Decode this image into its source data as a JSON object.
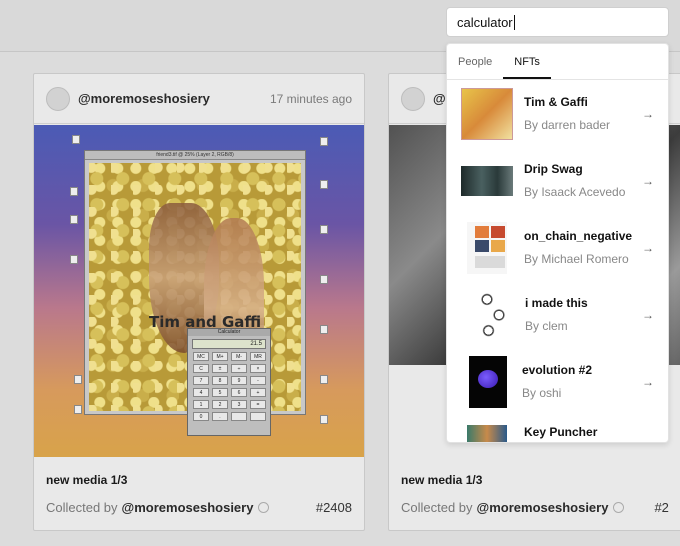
{
  "search": {
    "value": "calculator"
  },
  "tabs": [
    {
      "label": "People",
      "active": false
    },
    {
      "label": "NFTs",
      "active": true
    }
  ],
  "results": [
    {
      "name": "Tim & Gaffi",
      "by": "By darren bader"
    },
    {
      "name": "Drip Swag",
      "by": "By Isaack Acevedo"
    },
    {
      "name": "on_chain_negative",
      "by": "By Michael Romero"
    },
    {
      "name": "i made this",
      "by": "By clem"
    },
    {
      "name": "evolution #2",
      "by": "By oshi"
    },
    {
      "name": "Key Puncher",
      "by": ""
    }
  ],
  "card1": {
    "handle": "@moremoseshosiery",
    "time": "17 minutes ago",
    "title": "new media 1/3",
    "collected_label": "Collected by",
    "collector": "@moremoseshosiery",
    "number": "#2408",
    "art": {
      "caption": "Tim and Gaffi",
      "window_title": "friend3.tif @ 25% (Layer 2, RGB/8)",
      "calc_title": "Calculator",
      "calc_display": "21.5",
      "calc_keys": [
        "MC",
        "M+",
        "M-",
        "MR",
        "C",
        "±",
        "÷",
        "×",
        "7",
        "8",
        "9",
        "-",
        "4",
        "5",
        "6",
        "+",
        "1",
        "2",
        "3",
        "=",
        "0",
        ".",
        "",
        ""
      ]
    }
  },
  "card2": {
    "handle": "@",
    "title": "new media 1/3",
    "collected_label": "Collected by",
    "collector": "@moremoseshosiery",
    "number": "#2"
  },
  "icons": {
    "arrow": "arrow-right-icon"
  }
}
